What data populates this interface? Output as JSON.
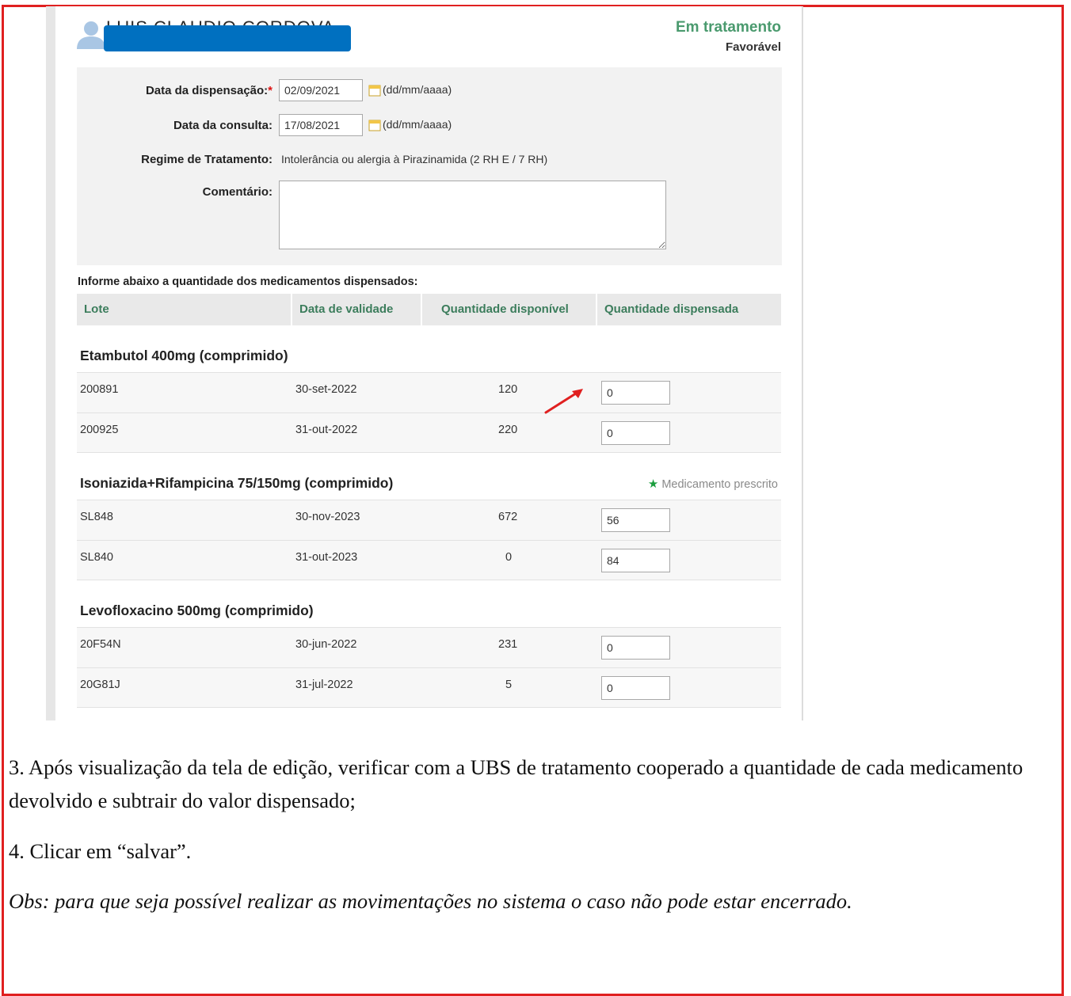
{
  "patient": {
    "name": "LUIS CLAUDIO CORDOVA",
    "id": "27714"
  },
  "status": {
    "main": "Em tratamento",
    "sub": "Favorável"
  },
  "form": {
    "dispensacao_label": "Data da dispensação:",
    "dispensacao_required": "*",
    "dispensacao_value": "02/09/2021",
    "consulta_label": "Data da consulta:",
    "consulta_value": "17/08/2021",
    "date_format": "(dd/mm/aaaa)",
    "regime_label": "Regime de Tratamento:",
    "regime_value": "Intolerância ou alergia à Pirazinamida (2 RH E / 7 RH)",
    "comentario_label": "Comentário:",
    "comentario_value": ""
  },
  "instructions": "Informe abaixo a quantidade dos medicamentos dispensados:",
  "table": {
    "headers": [
      "Lote",
      "Data de validade",
      "Quantidade disponível",
      "Quantidade dispensada"
    ],
    "groups": [
      {
        "name": "Etambutol 400mg (comprimido)",
        "rows": [
          {
            "lote": "200891",
            "validade": "30-set-2022",
            "disponivel": "120",
            "dispensada": "0"
          },
          {
            "lote": "200925",
            "validade": "31-out-2022",
            "disponivel": "220",
            "dispensada": "0"
          }
        ]
      },
      {
        "name": "Isoniazida+Rifampicina 75/150mg (comprimido)",
        "prescribed_label": "Medicamento prescrito",
        "rows": [
          {
            "lote": "SL848",
            "validade": "30-nov-2023",
            "disponivel": "672",
            "dispensada": "56"
          },
          {
            "lote": "SL840",
            "validade": "31-out-2023",
            "disponivel": "0",
            "dispensada": "84"
          }
        ]
      },
      {
        "name": "Levofloxacino 500mg (comprimido)",
        "rows": [
          {
            "lote": "20F54N",
            "validade": "30-jun-2022",
            "disponivel": "231",
            "dispensada": "0"
          },
          {
            "lote": "20G81J",
            "validade": "31-jul-2022",
            "disponivel": "5",
            "dispensada": "0"
          }
        ]
      }
    ]
  },
  "doc": {
    "step3": "3. Após visualização da tela de edição, verificar com a UBS de tratamento cooperado a quantidade de cada medicamento devolvido e subtrair do valor dispensado;",
    "step4": "4. Clicar em “salvar”.",
    "obs": "Obs: para que seja possível realizar as movimentações no sistema o caso não pode estar encerrado."
  },
  "colors": {
    "frame_border": "#e02020",
    "status_green": "#4a9a6e",
    "header_green": "#3c7d5c",
    "redaction_blue": "#0070c0",
    "arrow_red": "#e02020",
    "star_green": "#1b9e3e"
  }
}
